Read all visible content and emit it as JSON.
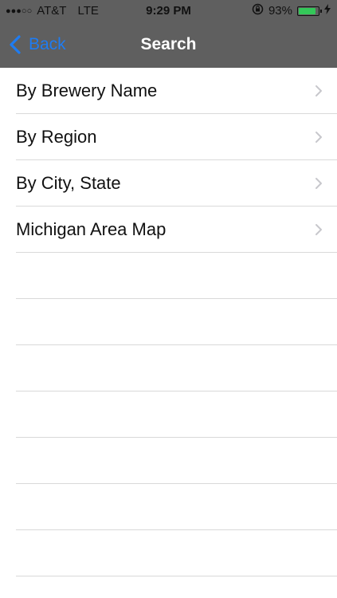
{
  "status_bar": {
    "signal": "●●●○○",
    "carrier": "AT&T",
    "network": "LTE",
    "time": "9:29 PM",
    "rotation_lock_icon": "rotation-lock-icon",
    "battery_percent_text": "93%",
    "battery_level": 0.93,
    "battery_color": "#34c759",
    "charging_icon": "bolt-icon"
  },
  "nav": {
    "back_label": "Back",
    "title": "Search",
    "accent_color": "#1e7cf2",
    "bar_color": "#5f5f5f"
  },
  "menu": {
    "items": [
      {
        "label": "By Brewery Name"
      },
      {
        "label": "By Region"
      },
      {
        "label": "By City, State"
      },
      {
        "label": "Michigan Area Map"
      }
    ]
  }
}
